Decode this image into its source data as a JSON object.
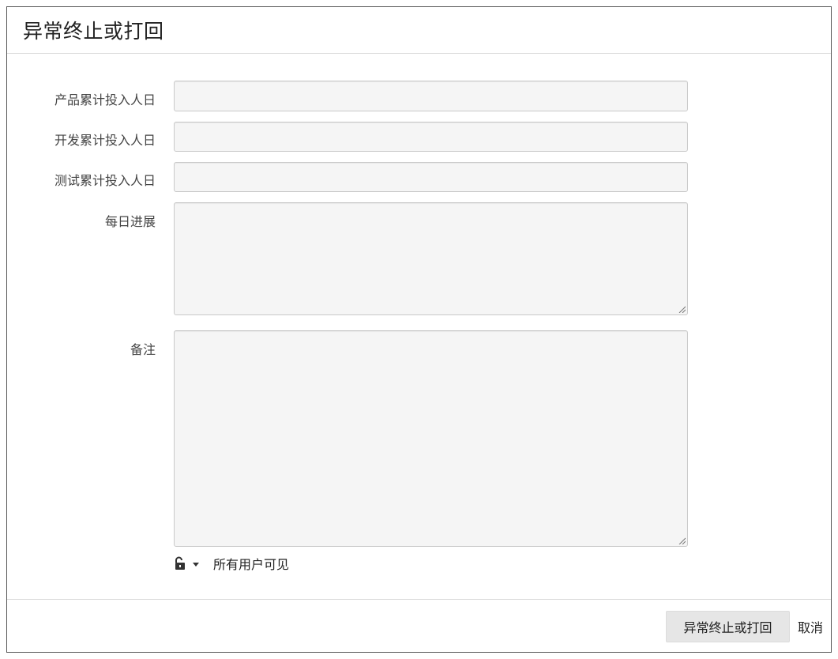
{
  "dialog": {
    "title": "异常终止或打回"
  },
  "form": {
    "fields": [
      {
        "label": "产品累计投入人日",
        "value": ""
      },
      {
        "label": "开发累计投入人日",
        "value": ""
      },
      {
        "label": "测试累计投入人日",
        "value": ""
      },
      {
        "label": "每日进展",
        "value": ""
      },
      {
        "label": "备注",
        "value": ""
      }
    ],
    "visibility": {
      "icon": "unlock-icon",
      "label": "所有用户可见"
    }
  },
  "footer": {
    "submit_label": "异常终止或打回",
    "cancel_label": "取消"
  },
  "colors": {
    "input_background": "#f5f5f5",
    "input_border": "#c9c9c9",
    "button_background": "#e6e6e6"
  }
}
